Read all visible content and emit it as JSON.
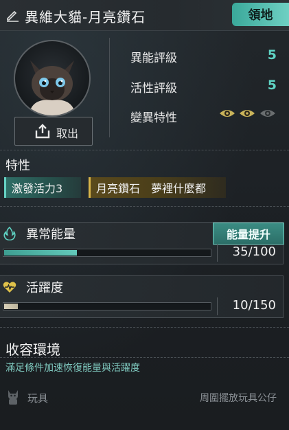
{
  "header": {
    "title": "異維大貓-月亮鑽石",
    "territory_button": "領地"
  },
  "avatar": {
    "takeout_label": "取出"
  },
  "stats": [
    {
      "label": "異能評級",
      "value": "5"
    },
    {
      "label": "活性評級",
      "value": "5"
    }
  ],
  "mutation": {
    "label": "變異特性",
    "active_eyes": 2,
    "total_eyes": 3
  },
  "traits": {
    "title": "特性",
    "tags": [
      "激發活力3",
      "月亮鑽石　夢裡什麼都"
    ]
  },
  "abnormal_energy": {
    "label": "異常能量",
    "boost_button": "能量提升",
    "current": 35,
    "max": 100,
    "value_text": "35/100"
  },
  "vitality": {
    "label": "活躍度",
    "current": 10,
    "max": 150,
    "value_text": "10/150"
  },
  "environment": {
    "title": "收容環境",
    "subtitle": "滿足條件加速恢復能量與活躍度",
    "toy_label": "玩具",
    "toy_desc": "周圍擺放玩具公仔"
  },
  "colors": {
    "accent": "#5fd3c4",
    "gold": "#d9b54a"
  }
}
